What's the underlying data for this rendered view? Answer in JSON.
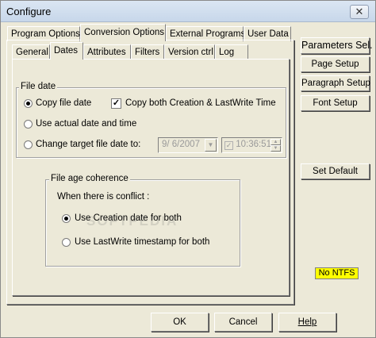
{
  "window": {
    "title": "Configure",
    "close_label": "✕"
  },
  "tabs_top": [
    "Program Options",
    "Conversion Options",
    "External Programs",
    "User Data"
  ],
  "tabs_sub": [
    "General",
    "Dates",
    "Attributes",
    "Filters",
    "Version ctrl",
    "Log"
  ],
  "file_date": {
    "group_label": "File date",
    "copy_label": "Copy file date",
    "copy_both_label": "Copy both Creation & LastWrite Time",
    "use_actual_label": "Use actual date and time",
    "change_target_label": "Change target file date to:",
    "date_value": "9/  6/2007",
    "time_value": "10:36:51",
    "time_check": "✓"
  },
  "file_age": {
    "group_label": "File age coherence",
    "conflict_label": "When there is conflict :",
    "use_creation_label": "Use Creation date for both",
    "use_lastwrite_label": "Use LastWrite timestamp for both"
  },
  "side_buttons": {
    "parameters": "Parameters Sel.",
    "page_setup": "Page Setup",
    "paragraph_setup": "Paragraph Setup",
    "font_setup": "Font Setup",
    "set_default": "Set Default"
  },
  "ntfs_badge": "No NTFS",
  "bottom_buttons": {
    "ok": "OK",
    "cancel": "Cancel",
    "help": "Help"
  },
  "watermark": "SOFTPEDIA"
}
